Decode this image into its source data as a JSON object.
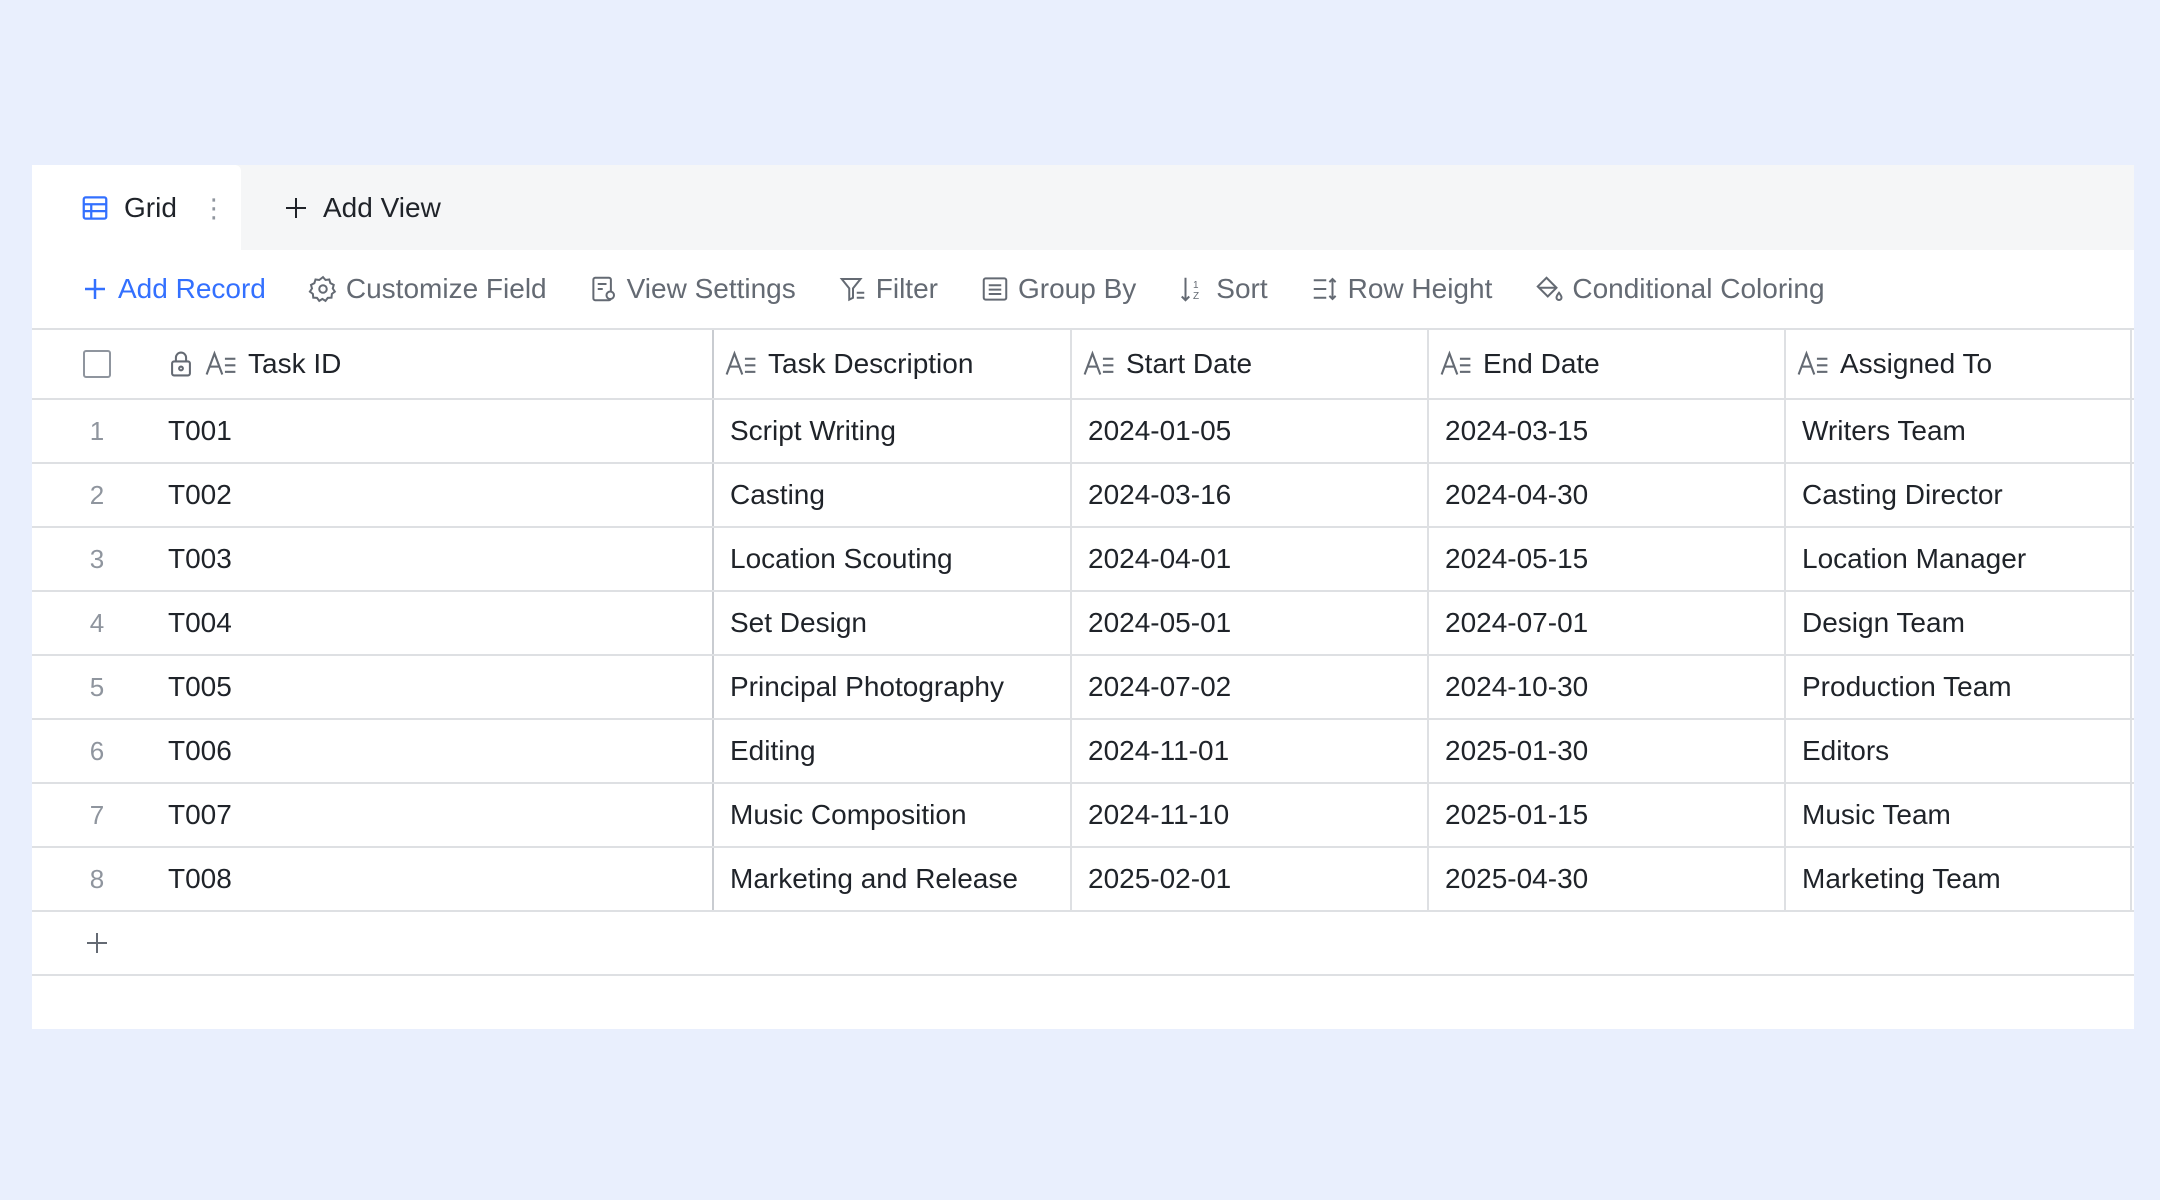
{
  "tabs": {
    "active": {
      "label": "Grid",
      "icon": "grid-table-icon"
    },
    "add_view_label": "Add View"
  },
  "toolbar": {
    "add_record": "Add Record",
    "customize_field": "Customize Field",
    "view_settings": "View Settings",
    "filter": "Filter",
    "group_by": "Group By",
    "sort": "Sort",
    "row_height": "Row Height",
    "conditional_coloring": "Conditional Coloring"
  },
  "table": {
    "columns": [
      "Task ID",
      "Task Description",
      "Start Date",
      "End Date",
      "Assigned To"
    ],
    "rows": [
      {
        "num": "1",
        "id": "T001",
        "desc": "Script Writing",
        "start": "2024-01-05",
        "end": "2024-03-15",
        "assigned": "Writers Team"
      },
      {
        "num": "2",
        "id": "T002",
        "desc": "Casting",
        "start": "2024-03-16",
        "end": "2024-04-30",
        "assigned": "Casting Director"
      },
      {
        "num": "3",
        "id": "T003",
        "desc": "Location Scouting",
        "start": "2024-04-01",
        "end": "2024-05-15",
        "assigned": "Location Manager"
      },
      {
        "num": "4",
        "id": "T004",
        "desc": "Set Design",
        "start": "2024-05-01",
        "end": "2024-07-01",
        "assigned": "Design Team"
      },
      {
        "num": "5",
        "id": "T005",
        "desc": "Principal Photography",
        "start": "2024-07-02",
        "end": "2024-10-30",
        "assigned": "Production Team"
      },
      {
        "num": "6",
        "id": "T006",
        "desc": "Editing",
        "start": "2024-11-01",
        "end": "2025-01-30",
        "assigned": "Editors"
      },
      {
        "num": "7",
        "id": "T007",
        "desc": "Music Composition",
        "start": "2024-11-10",
        "end": "2025-01-15",
        "assigned": "Music Team"
      },
      {
        "num": "8",
        "id": "T008",
        "desc": "Marketing and Release",
        "start": "2025-02-01",
        "end": "2025-04-30",
        "assigned": "Marketing Team"
      }
    ]
  },
  "colors": {
    "background": "#e9effd",
    "accent": "#3370ff",
    "muted_text": "#646a73",
    "border": "#dee0e3"
  }
}
